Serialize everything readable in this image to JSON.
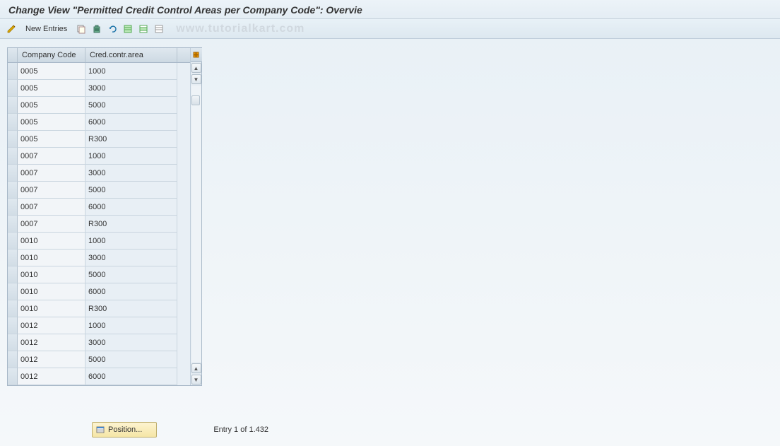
{
  "title": "Change View \"Permitted Credit Control Areas per Company Code\": Overvie",
  "toolbar": {
    "new_entries_label": "New Entries",
    "watermark": "www.tutorialkart.com"
  },
  "table": {
    "columns": {
      "company_code": "Company Code",
      "cred_area": "Cred.contr.area"
    },
    "rows": [
      {
        "company": "0005",
        "cred": "1000"
      },
      {
        "company": "0005",
        "cred": "3000"
      },
      {
        "company": "0005",
        "cred": "5000"
      },
      {
        "company": "0005",
        "cred": "6000"
      },
      {
        "company": "0005",
        "cred": "R300"
      },
      {
        "company": "0007",
        "cred": "1000"
      },
      {
        "company": "0007",
        "cred": "3000"
      },
      {
        "company": "0007",
        "cred": "5000"
      },
      {
        "company": "0007",
        "cred": "6000"
      },
      {
        "company": "0007",
        "cred": "R300"
      },
      {
        "company": "0010",
        "cred": "1000"
      },
      {
        "company": "0010",
        "cred": "3000"
      },
      {
        "company": "0010",
        "cred": "5000"
      },
      {
        "company": "0010",
        "cred": "6000"
      },
      {
        "company": "0010",
        "cred": "R300"
      },
      {
        "company": "0012",
        "cred": "1000"
      },
      {
        "company": "0012",
        "cred": "3000"
      },
      {
        "company": "0012",
        "cred": "5000"
      },
      {
        "company": "0012",
        "cred": "6000"
      }
    ]
  },
  "footer": {
    "position_label": "Position...",
    "entry_status": "Entry 1 of 1.432"
  }
}
